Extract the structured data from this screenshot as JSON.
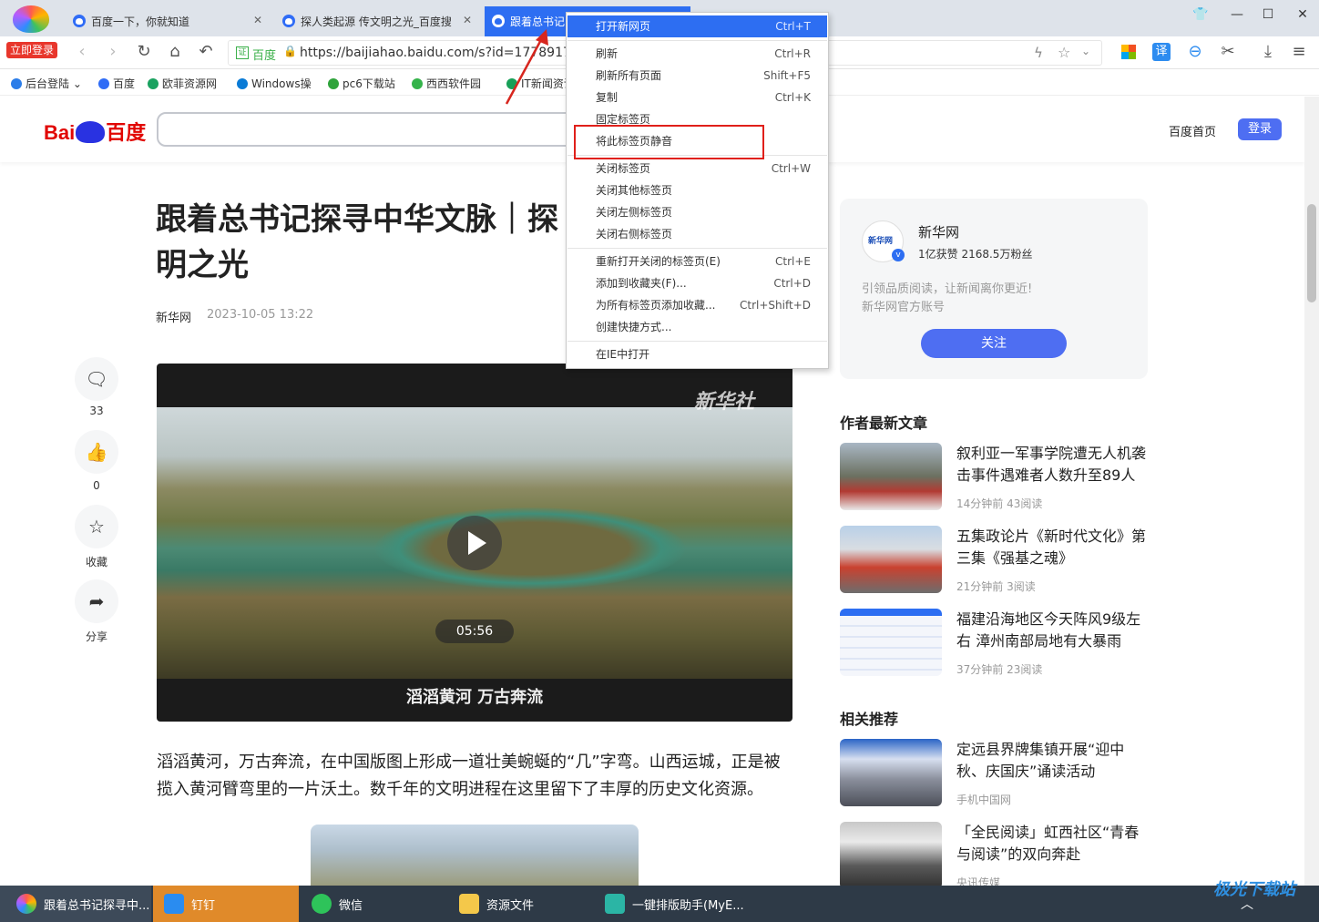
{
  "browser": {
    "login_badge": "立即登录",
    "tabs": [
      {
        "title": "百度一下，你就知道"
      },
      {
        "title": "探人类起源 传文明之光_百度搜"
      },
      {
        "title": "跟着总书记"
      }
    ],
    "url_prefix": "百度",
    "url": "https://baijiahao.baidu.com/s?id=1778917",
    "translate_icon": "译"
  },
  "bookmarks": [
    "后台登陆",
    "百度",
    "欧菲资源网",
    "Windows操",
    "pc6下载站",
    "西西软件园",
    "IT新闻资讯"
  ],
  "context_menu": {
    "items": [
      {
        "label": "打开新网页",
        "shortcut": "Ctrl+T"
      },
      {
        "label": "刷新",
        "shortcut": "Ctrl+R"
      },
      {
        "label": "刷新所有页面",
        "shortcut": "Shift+F5"
      },
      {
        "label": "复制",
        "shortcut": "Ctrl+K"
      },
      {
        "label": "固定标签页",
        "shortcut": ""
      },
      {
        "label": "将此标签页静音",
        "shortcut": ""
      },
      {
        "label": "关闭标签页",
        "shortcut": "Ctrl+W"
      },
      {
        "label": "关闭其他标签页",
        "shortcut": ""
      },
      {
        "label": "关闭左侧标签页",
        "shortcut": ""
      },
      {
        "label": "关闭右侧标签页",
        "shortcut": ""
      },
      {
        "label": "重新打开关闭的标签页(E)",
        "shortcut": "Ctrl+E"
      },
      {
        "label": "添加到收藏夹(F)...",
        "shortcut": "Ctrl+D"
      },
      {
        "label": "为所有标签页添加收藏...",
        "shortcut": "Ctrl+Shift+D"
      },
      {
        "label": "创建快捷方式...",
        "shortcut": ""
      },
      {
        "label": "在IE中打开",
        "shortcut": ""
      }
    ]
  },
  "site": {
    "logo": "Bai du百度",
    "logo_left": "Bai",
    "logo_right": "百度",
    "home_link": "百度首页",
    "login_button": "登录"
  },
  "article": {
    "title_line1": "跟着总书记探寻中华文脉｜探",
    "title_line2": "明之光",
    "source": "新华网",
    "date": "2023-10-05 13:22",
    "video_watermark": "新华社",
    "video_duration": "05:56",
    "video_caption": "滔滔黄河 万古奔流",
    "paragraph": "滔滔黄河，万古奔流，在中国版图上形成一道壮美蜿蜒的“几”字弯。山西运城，正是被揽入黄河臂弯里的一片沃土。数千年的文明进程在这里留下了丰厚的历史文化资源。"
  },
  "side_actions": [
    {
      "icon": "comment-icon",
      "label": "33"
    },
    {
      "icon": "like-icon",
      "label": "0"
    },
    {
      "icon": "star-icon",
      "label": "收藏"
    },
    {
      "icon": "share-icon",
      "label": "分享"
    }
  ],
  "author": {
    "name": "新华网",
    "stats": "1亿获赞 2168.5万粉丝",
    "desc1": "引领品质阅读，让新闻离你更近!",
    "desc2": "新华网官方账号",
    "follow": "关注",
    "avatar_text": "新华网"
  },
  "latest": {
    "heading": "作者最新文章",
    "items": [
      {
        "title": "叙利亚一军事学院遭无人机袭击事件遇难者人数升至89人",
        "meta": "14分钟前   43阅读"
      },
      {
        "title": "五集政论片《新时代文化》第三集《强基之魂》",
        "meta": "21分钟前   3阅读"
      },
      {
        "title": "福建沿海地区今天阵风9级左右 漳州南部局地有大暴雨",
        "meta": "37分钟前   23阅读"
      }
    ]
  },
  "related": {
    "heading": "相关推荐",
    "items": [
      {
        "title": "定远县界牌集镇开展“迎中秋、庆国庆”诵读活动",
        "meta": "手机中国网"
      },
      {
        "title": "「全民阅读」虹西社区“青春与阅读”的双向奔赴",
        "meta": "央讯传媒"
      }
    ]
  },
  "taskbar": {
    "items": [
      "跟着总书记探寻中...",
      "钉钉",
      "微信",
      "资源文件",
      "一键排版助手(MyE..."
    ],
    "watermark": "极光下载站"
  }
}
